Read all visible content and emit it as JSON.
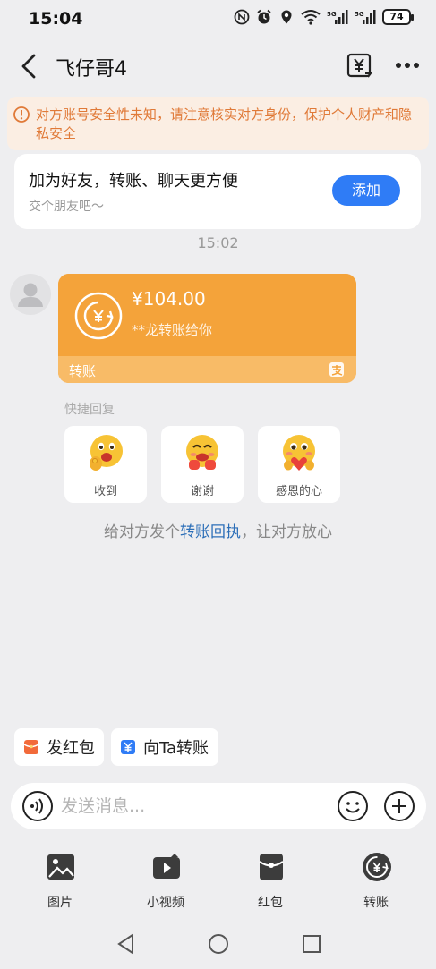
{
  "status_bar": {
    "time": "15:04",
    "battery": "74",
    "icons": [
      "nfc-icon",
      "alarm-icon",
      "location-icon",
      "wifi-icon",
      "5g-signal-icon",
      "5g-signal-icon",
      "battery-icon"
    ]
  },
  "header": {
    "title": "飞仔哥4",
    "back_icon": "chevron-left-icon",
    "transfer_record_icon": "yuan-receipt-icon",
    "more_icon": "more-dots-icon"
  },
  "warning": {
    "text": "对方账号安全性未知，请注意核实对方身份，保护个人财产和隐私安全"
  },
  "friend_card": {
    "title": "加为好友，转账、聊天更方便",
    "subtitle": "交个朋友吧～",
    "button": "添加"
  },
  "chat": {
    "time": "15:02",
    "transfer": {
      "amount": "¥104.00",
      "note": "**龙转账给你",
      "label": "转账"
    },
    "quick_reply": {
      "title": "快捷回复",
      "items": [
        {
          "label": "收到"
        },
        {
          "label": "谢谢"
        },
        {
          "label": "感恩的心"
        }
      ]
    },
    "receipt_hint": {
      "before": "给对方发个",
      "link": "转账回执",
      "after": "，让对方放心"
    }
  },
  "shortcuts": {
    "red_packet": "发红包",
    "transfer_to": "向Ta转账"
  },
  "input": {
    "placeholder": "发送消息..."
  },
  "toolbar": {
    "items": [
      {
        "label": "图片",
        "icon": "image-icon"
      },
      {
        "label": "小视频",
        "icon": "video-icon"
      },
      {
        "label": "红包",
        "icon": "red-packet-icon"
      },
      {
        "label": "转账",
        "icon": "transfer-icon"
      }
    ]
  },
  "colors": {
    "accent_blue": "#2f7cf6",
    "transfer_orange": "#f4a33a",
    "warning_orange": "#e07a38",
    "link_blue": "#2d6fb8"
  }
}
